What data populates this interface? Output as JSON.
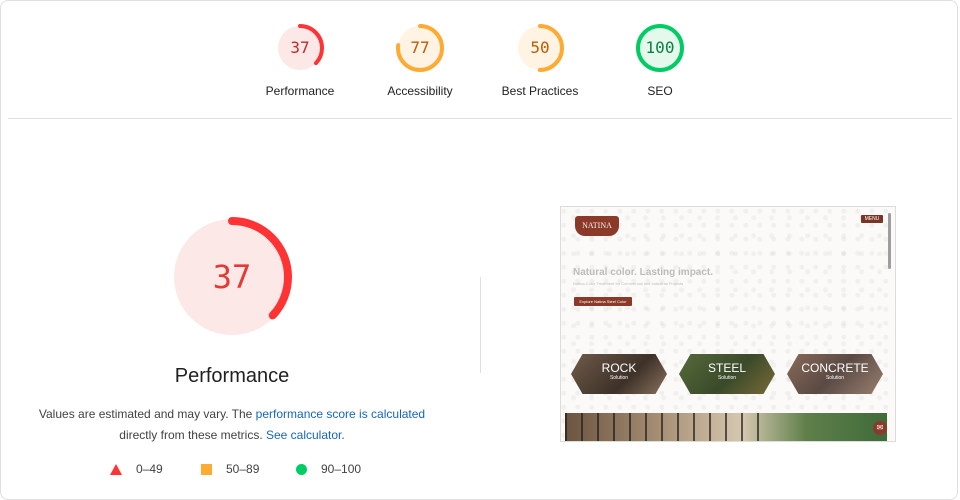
{
  "categories": [
    {
      "label": "Performance",
      "score": 37,
      "color": "#ff3333",
      "track": "#fde8e8",
      "text": "#c62828"
    },
    {
      "label": "Accessibility",
      "score": 77,
      "color": "#ffaa33",
      "track": "#fff3e3",
      "text": "#c35a00"
    },
    {
      "label": "Best Practices",
      "score": 50,
      "color": "#ffaa33",
      "track": "#fff3e3",
      "text": "#c35a00"
    },
    {
      "label": "SEO",
      "score": 100,
      "color": "#00cc66",
      "track": "#e4f8ec",
      "text": "#0b8043"
    }
  ],
  "detail": {
    "score": 37,
    "title": "Performance",
    "desc_prefix": "Values are estimated and may vary. The ",
    "desc_link1": "performance score is calculated",
    "desc_middle": " directly from these metrics. ",
    "desc_link2": "See calculator",
    "desc_suffix": "."
  },
  "legend": [
    {
      "shape": "triangle",
      "label": "0–49"
    },
    {
      "shape": "square",
      "label": "50–89"
    },
    {
      "shape": "circle",
      "label": "90–100"
    }
  ],
  "screenshot": {
    "logo": "NATINA",
    "menu_label": "MENU",
    "hero_heading": "Natural color. Lasting impact.",
    "hero_sub": "Natina Color Treatment for Commercial and Industrial Projects",
    "hero_button": "Explore Natina Steel Color",
    "tiles": [
      {
        "title": "ROCK",
        "sub": "Solution"
      },
      {
        "title": "STEEL",
        "sub": "Solution"
      },
      {
        "title": "CONCRETE",
        "sub": "Solution"
      }
    ]
  }
}
